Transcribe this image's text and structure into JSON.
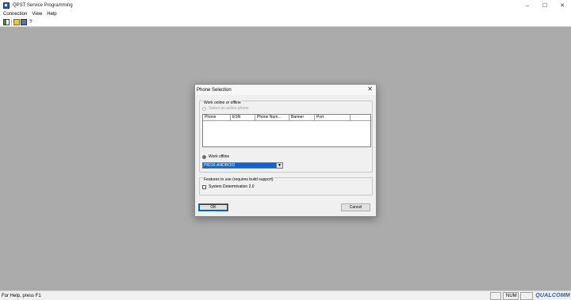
{
  "window": {
    "title": "QPST Service Programming",
    "minimize": "–",
    "maximize": "☐",
    "close": "✕"
  },
  "menu": [
    "Connection",
    "View",
    "Help"
  ],
  "toolbar": {
    "buttons": [
      "connect-icon",
      "open-icon",
      "save-icon",
      "help-icon"
    ],
    "help_glyph": "?"
  },
  "status": {
    "help_text": "For Help, press F1",
    "num": "NUM",
    "logo": "QUALCOMM"
  },
  "dialog": {
    "title": "Phone Selection",
    "close": "✕",
    "group_online_label": "Work online or offline",
    "radio_online_label": "Select an active phone",
    "columns": [
      "Phone",
      "ESN",
      "Phone Num...",
      "Banner",
      "Port",
      ""
    ],
    "radio_offline_label": "Work offline",
    "offline_model": "P8216-ANDROID",
    "combo_arrow": "▼",
    "group_features_label": "Features to use (requires build support)",
    "feature_checkbox_label": "System Determination 2.0",
    "ok": "OK",
    "cancel": "Cancel"
  },
  "colors": {
    "workspace": "#ababab",
    "selection": "#0a64d6",
    "logo": "#2b59c3"
  }
}
